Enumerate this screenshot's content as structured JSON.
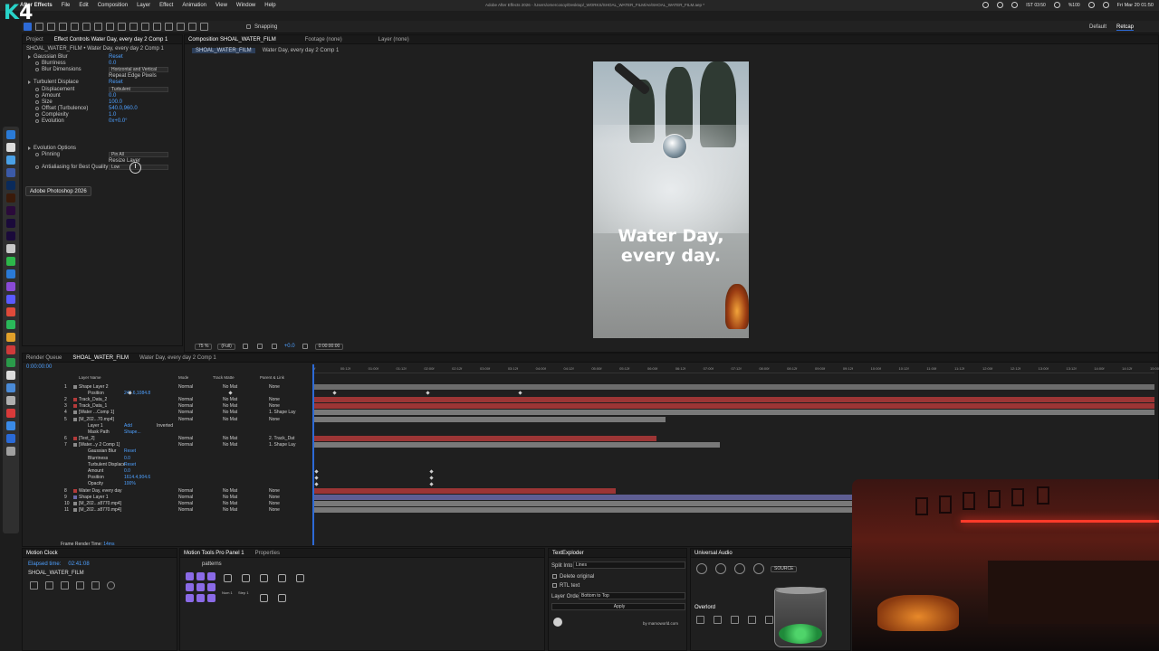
{
  "menubar": {
    "app_name": "After Effects",
    "items": [
      "File",
      "Edit",
      "Composition",
      "Layer",
      "Effect",
      "Animation",
      "View",
      "Window",
      "Help"
    ],
    "window_title": "Adobe After Effects 2026 - /Users/omercosoy/Desktop/_WORKS/SHOAL_WATER_FILM/Ae/SHOAL_WATER_FILM.aep *",
    "clock_ist": "IST 03:50",
    "battery": "%100",
    "datetime": "Fri Mar 20  01:50"
  },
  "logo": {
    "k": "K",
    "num": "4"
  },
  "toolbar": {
    "snapping": "Snapping",
    "workspace_default": "Default",
    "workspace_retcap": "Retcap"
  },
  "effects_panel": {
    "tabs": [
      "Project",
      "Effect Controls Water Day, every day 2 Comp 1"
    ],
    "breadcrumb": "SHOAL_WATER_FILM • Water Day, every day 2 Comp 1",
    "rows": [
      {
        "name": "Gaussian Blur",
        "value": "Reset",
        "kind": "fx"
      },
      {
        "name": "Blurriness",
        "value": "0.0",
        "kind": "prop"
      },
      {
        "name": "Blur Dimensions",
        "value": "Horizontal and Vertical",
        "kind": "dd"
      },
      {
        "name": "",
        "value": "Repeat Edge Pixels",
        "kind": "check"
      },
      {
        "name": "Turbulent Displace",
        "value": "Reset",
        "kind": "fx"
      },
      {
        "name": "Displacement",
        "value": "Turbulent",
        "kind": "dd"
      },
      {
        "name": "Amount",
        "value": "0.0",
        "kind": "prop"
      },
      {
        "name": "Size",
        "value": "100.0",
        "kind": "prop"
      },
      {
        "name": "Offset (Turbulence)",
        "value": "540.0,960.0",
        "kind": "prop"
      },
      {
        "name": "Complexity",
        "value": "1.0",
        "kind": "prop"
      },
      {
        "name": "Evolution",
        "value": "0x+0.0°",
        "kind": "prop"
      }
    ],
    "evolution_options": [
      {
        "name": "Evolution Options",
        "value": "",
        "kind": "fx"
      },
      {
        "name": "Pinning",
        "value": "Pin All",
        "kind": "dd"
      },
      {
        "name": "",
        "value": "Resize Layer",
        "kind": "check"
      },
      {
        "name": "Antialiasing for Best Quality",
        "value": "Low",
        "kind": "dd"
      }
    ],
    "tooltip": "Adobe Photoshop 2026"
  },
  "comp_panel": {
    "tabs": [
      "Composition SHOAL_WATER_FILM",
      "Footage (none)",
      "Layer (none)"
    ],
    "crumbs": [
      "SHOAL_WATER_FILM",
      "Water Day, every day 2 Comp 1"
    ],
    "overlay_line1": "Water Day,",
    "overlay_line2": "every day.",
    "zoom": "75 %",
    "resolution": "(Full)",
    "timecode": "0:00:00:00",
    "exposure": "+0.0"
  },
  "timeline": {
    "tabs": [
      "Render Queue",
      "SHOAL_WATER_FILM",
      "Water Day, every day 2 Comp 1"
    ],
    "current_time": "0:00:00:00",
    "columns": [
      "Layer Name",
      "Mode",
      "Track Matte",
      "Parent & Link"
    ],
    "ruler_ticks": [
      "0f",
      "00:12f",
      "01:00f",
      "01:12f",
      "02:00f",
      "02:12f",
      "03:00f",
      "03:12f",
      "04:00f",
      "04:12f",
      "05:00f",
      "05:12f",
      "06:00f",
      "06:12f",
      "07:00f",
      "07:12f",
      "08:00f",
      "08:12f",
      "09:00f",
      "09:12f",
      "10:00f",
      "10:12f",
      "11:00f",
      "11:12f",
      "12:00f",
      "12:12f",
      "13:00f",
      "13:12f",
      "14:00f",
      "14:12f",
      "15:00f"
    ],
    "layers": [
      {
        "num": "1",
        "name": "Shape Layer 2",
        "mode": "Normal",
        "matte": "No Mat",
        "parent": "None",
        "color": "#8a8a8a"
      },
      {
        "num": "",
        "name": "Position",
        "value": "246.6,1084.8",
        "kind": "prop"
      },
      {
        "num": "2",
        "name": "Track_Data_2",
        "mode": "Normal",
        "matte": "No Mat",
        "parent": "None",
        "color": "#b33a3a"
      },
      {
        "num": "3",
        "name": "Track_Data_1",
        "mode": "Normal",
        "matte": "No Mat",
        "parent": "None",
        "color": "#b33a3a"
      },
      {
        "num": "4",
        "name": "[Water ...Comp 1]",
        "mode": "Normal",
        "matte": "No Mat",
        "parent": "1. Shape Lay",
        "color": "#8a8a8a"
      },
      {
        "num": "5",
        "name": "[M_202...70.mp4]",
        "mode": "Normal",
        "matte": "No Mat",
        "parent": "None",
        "color": "#8a8a8a"
      },
      {
        "num": "",
        "name": "Layer 1",
        "value": "Add",
        "extra": "Inverted",
        "kind": "prop"
      },
      {
        "num": "",
        "name": "Mask Path",
        "value": "Shape...",
        "kind": "prop"
      },
      {
        "num": "6",
        "name": "[Text_2]",
        "mode": "Normal",
        "matte": "No Mat",
        "parent": "2. Track_Dat",
        "color": "#b33a3a"
      },
      {
        "num": "7",
        "name": "[Water...y 2 Comp 1]",
        "mode": "Normal",
        "matte": "No Mat",
        "parent": "1. Shape Lay",
        "color": "#8a8a8a"
      },
      {
        "num": "",
        "name": "Gaussian Blur",
        "value": "Reset",
        "kind": "prop"
      },
      {
        "num": "",
        "name": "Blurriness",
        "value": "0.0",
        "kind": "prop"
      },
      {
        "num": "",
        "name": "Turbulent Displace",
        "value": "Reset",
        "kind": "prop"
      },
      {
        "num": "",
        "name": "Amount",
        "value": "0.0",
        "kind": "prop"
      },
      {
        "num": "",
        "name": "Position",
        "value": "1614.4,904.6",
        "kind": "prop"
      },
      {
        "num": "",
        "name": "Opacity",
        "value": "100%",
        "kind": "prop"
      },
      {
        "num": "8",
        "name": "Water Day, every day",
        "mode": "Normal",
        "matte": "No Mat",
        "parent": "None",
        "color": "#b33a3a"
      },
      {
        "num": "9",
        "name": "Shape Layer 1",
        "mode": "Normal",
        "matte": "No Mat",
        "parent": "None",
        "color": "#6a6aa8"
      },
      {
        "num": "10",
        "name": "[M_202...s8770.mp4]",
        "mode": "Normal",
        "matte": "No Mat",
        "parent": "None",
        "color": "#8a8a8a"
      },
      {
        "num": "11",
        "name": "[M_202...s8770.mp4]",
        "mode": "Normal",
        "matte": "No Mat",
        "parent": "None",
        "color": "#8a8a8a"
      }
    ],
    "frame_render_label": "Frame Render Time:",
    "frame_render_value": "14ms"
  },
  "motion_clock": {
    "title": "Motion Clock",
    "elapsed_label": "Elapsed time:",
    "elapsed_value": "02:41:08",
    "project": "SHOAL_WATER_FILM"
  },
  "motion_tools": {
    "tabs": [
      "Motion Tools Pro Panel 1",
      "Properties"
    ],
    "search": "patterns",
    "btn_a": "Num 1",
    "btn_b": "Step 1"
  },
  "text_exploder": {
    "title": "TextExploder",
    "split_label": "Split Into",
    "split_value": "Lines",
    "delete_original": "Delete original",
    "rtl": "RTL text",
    "order_label": "Layer Order",
    "order_value": "Bottom to Top",
    "apply": "Apply",
    "credit": "by mamoworld.com"
  },
  "universal_audio": {
    "title": "Universal Audio",
    "source": "SOURCE",
    "overlord": "Overlord"
  }
}
